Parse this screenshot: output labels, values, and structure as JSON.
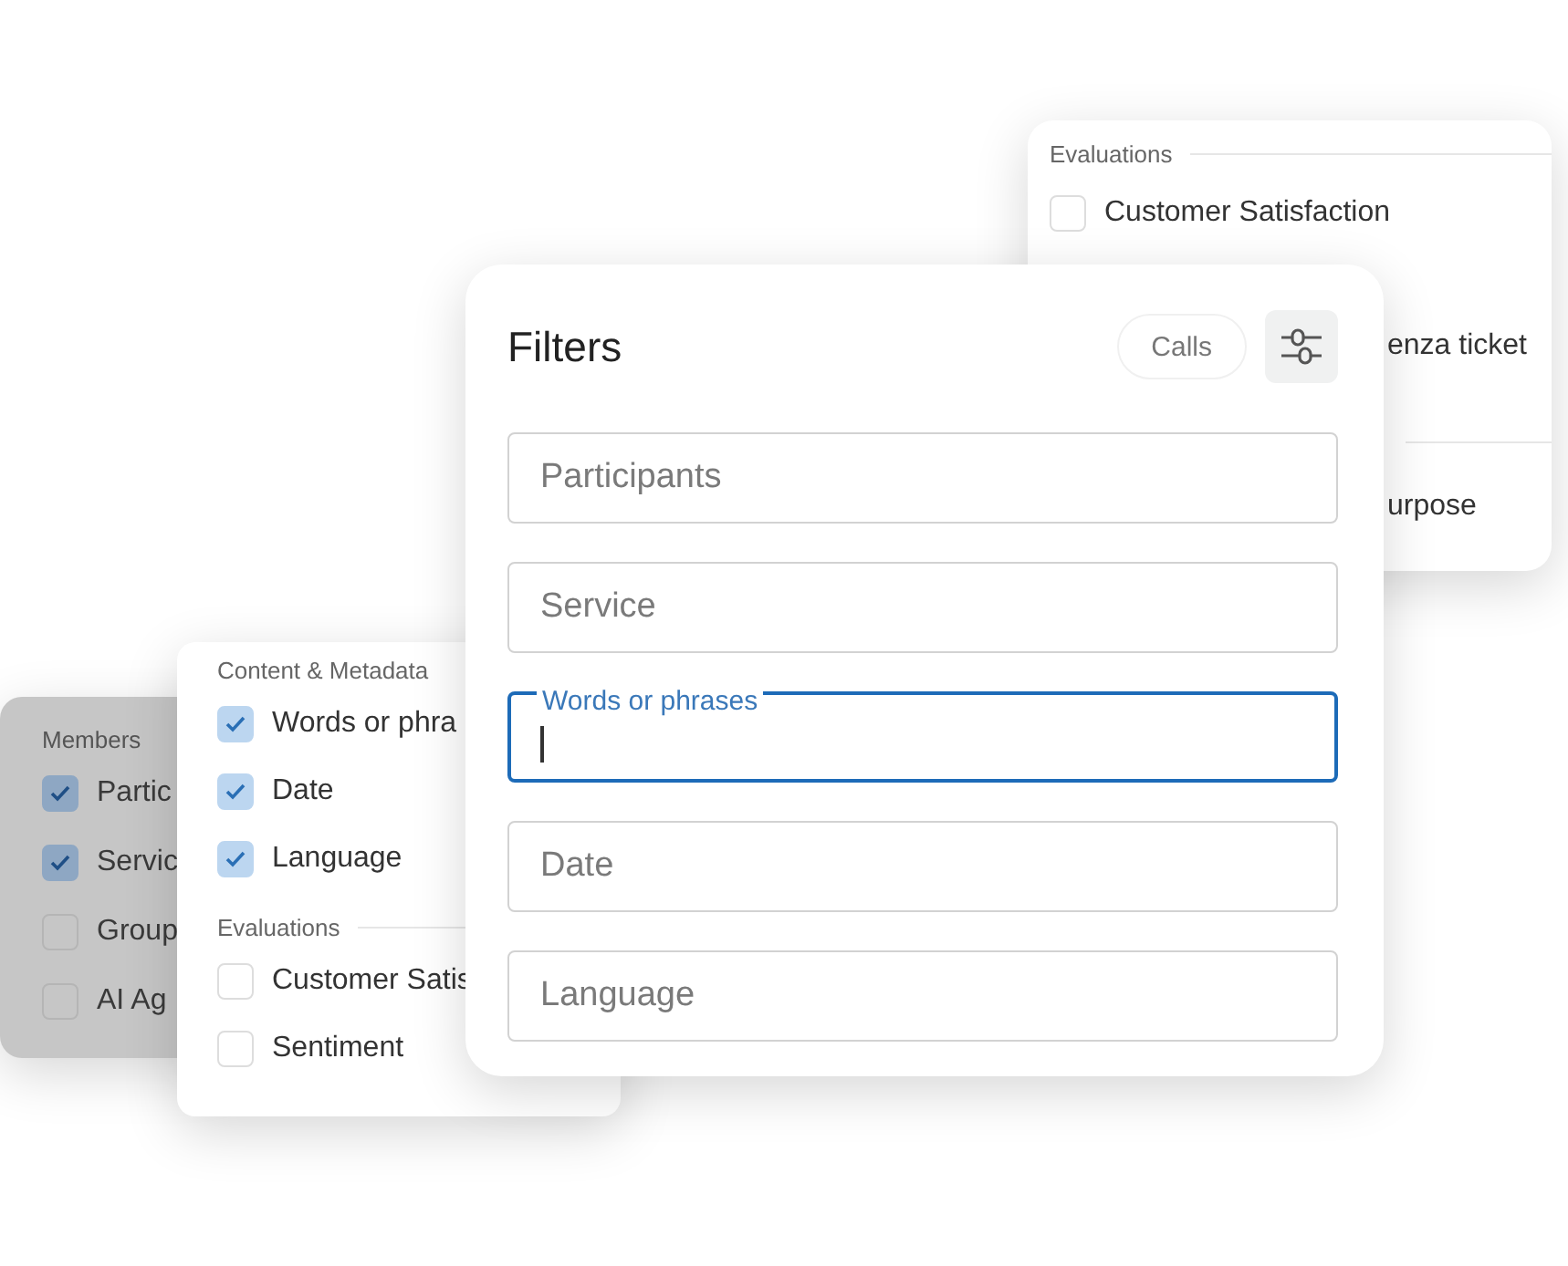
{
  "back_card": {
    "sections": [
      {
        "title": "Evaluations",
        "items": [
          {
            "kind": "checkbox",
            "label": "Customer Satisfaction",
            "checked": false
          },
          {
            "kind": "text",
            "label": "enza ticket"
          }
        ]
      },
      {
        "items": [
          {
            "kind": "text",
            "label": "urpose"
          }
        ]
      }
    ]
  },
  "members_card": {
    "title": "Members",
    "items": [
      {
        "label": "Partic",
        "checked": true
      },
      {
        "label": "Servic",
        "checked": true
      },
      {
        "label": "Group",
        "checked": false
      },
      {
        "label": "AI Ag",
        "checked": false
      }
    ]
  },
  "content_card": {
    "sections": [
      {
        "title": "Content & Metadata",
        "items": [
          {
            "label": "Words or phra",
            "checked": true
          },
          {
            "label": "Date",
            "checked": true
          },
          {
            "label": "Language",
            "checked": true
          }
        ]
      },
      {
        "title": "Evaluations",
        "items": [
          {
            "label": "Customer Satis",
            "checked": false
          },
          {
            "label": "Sentiment",
            "checked": false
          }
        ]
      }
    ]
  },
  "filters": {
    "title": "Filters",
    "chip": "Calls",
    "fields": [
      {
        "placeholder": "Participants",
        "focused": false
      },
      {
        "placeholder": "Service",
        "focused": false
      },
      {
        "placeholder": "Words or phrases",
        "focused": true
      },
      {
        "placeholder": "Date",
        "focused": false
      },
      {
        "placeholder": "Language",
        "focused": false
      }
    ]
  }
}
